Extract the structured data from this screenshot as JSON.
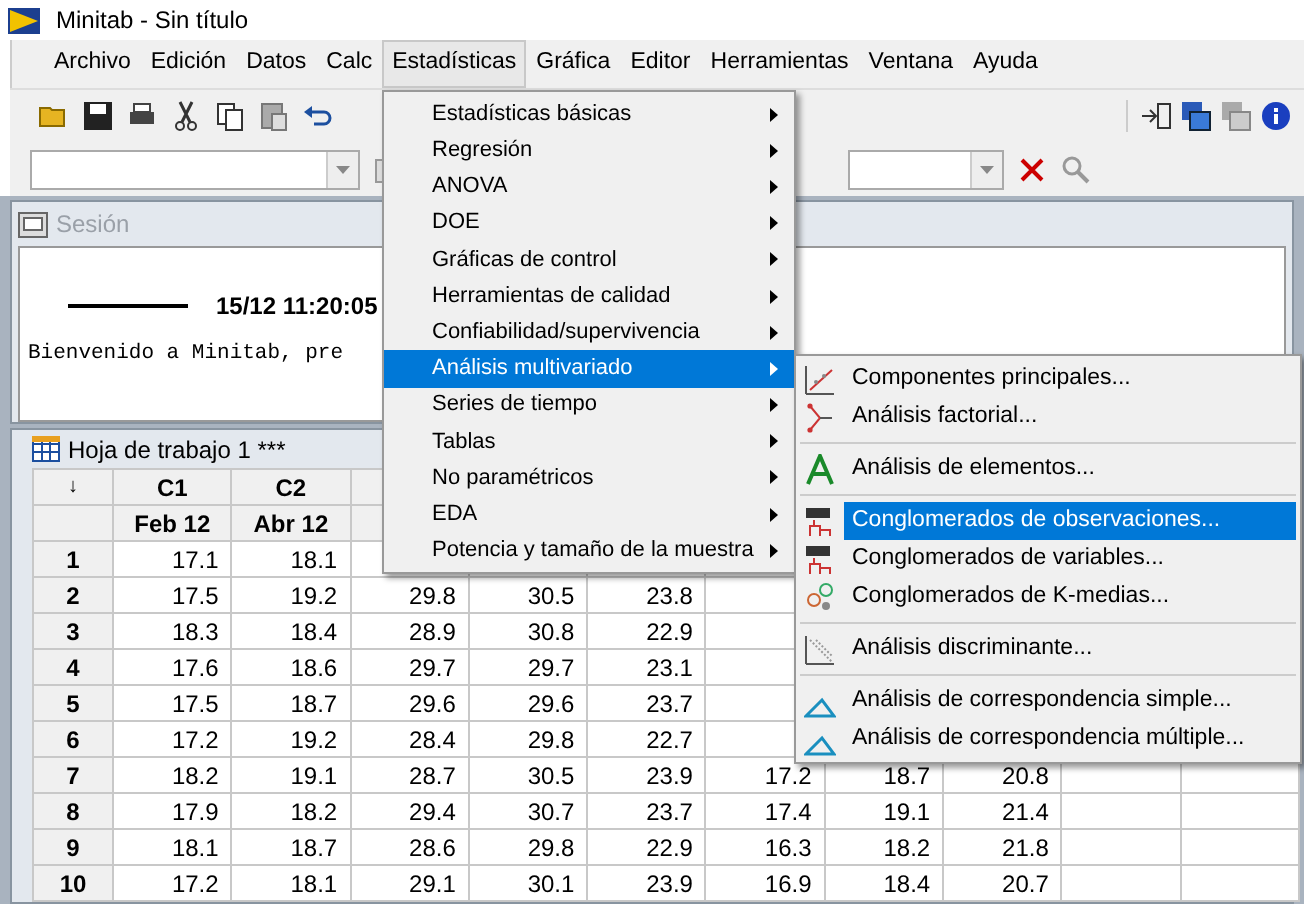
{
  "window": {
    "title": "Minitab - Sin título"
  },
  "menubar": [
    {
      "label": "Archivo",
      "selected": false
    },
    {
      "label": "Edición",
      "selected": false
    },
    {
      "label": "Datos",
      "selected": false
    },
    {
      "label": "Calc",
      "selected": false
    },
    {
      "label": "Estadísticas",
      "selected": true
    },
    {
      "label": "Gráfica",
      "selected": false
    },
    {
      "label": "Editor",
      "selected": false
    },
    {
      "label": "Herramientas",
      "selected": false
    },
    {
      "label": "Ventana",
      "selected": false
    },
    {
      "label": "Ayuda",
      "selected": false
    }
  ],
  "session": {
    "title": "Sesión",
    "timestamp": "15/12 11:20:05",
    "message": "Bienvenido a Minitab, pre"
  },
  "worksheet": {
    "title": "Hoja de trabajo 1 ***",
    "corner": "↓",
    "columns": [
      {
        "name": "C1",
        "label": "Feb 12"
      },
      {
        "name": "C2",
        "label": "Abr 12"
      }
    ],
    "rows": [
      {
        "number": "1",
        "cells": [
          "17.1",
          "18.1"
        ]
      },
      {
        "number": "2",
        "cells": [
          "17.5",
          "19.2",
          "29.8",
          "30.5",
          "23.8"
        ]
      },
      {
        "number": "3",
        "cells": [
          "18.3",
          "18.4",
          "28.9",
          "30.8",
          "22.9"
        ]
      },
      {
        "number": "4",
        "cells": [
          "17.6",
          "18.6",
          "29.7",
          "29.7",
          "23.1"
        ]
      },
      {
        "number": "5",
        "cells": [
          "17.5",
          "18.7",
          "29.6",
          "29.6",
          "23.7"
        ]
      },
      {
        "number": "6",
        "cells": [
          "17.2",
          "19.2",
          "28.4",
          "29.8",
          "22.7"
        ]
      },
      {
        "number": "7",
        "cells": [
          "18.2",
          "19.1",
          "28.7",
          "30.5",
          "23.9",
          "17.2",
          "18.7",
          "20.8"
        ]
      },
      {
        "number": "8",
        "cells": [
          "17.9",
          "18.2",
          "29.4",
          "30.7",
          "23.7",
          "17.4",
          "19.1",
          "21.4"
        ]
      },
      {
        "number": "9",
        "cells": [
          "18.1",
          "18.7",
          "28.6",
          "29.8",
          "22.9",
          "16.3",
          "18.2",
          "21.8"
        ]
      },
      {
        "number": "10",
        "cells": [
          "17.2",
          "18.1",
          "29.1",
          "30.1",
          "23.9",
          "16.9",
          "18.4",
          "20.7"
        ]
      }
    ]
  },
  "menu": [
    {
      "label": "Estadísticas básicas",
      "selected": false
    },
    {
      "label": "Regresión",
      "selected": false
    },
    {
      "label": "ANOVA",
      "selected": false
    },
    {
      "label": "DOE",
      "selected": false
    },
    {
      "label": "Gráficas de control",
      "selected": false
    },
    {
      "label": "Herramientas de calidad",
      "selected": false
    },
    {
      "label": "Confiabilidad/supervivencia",
      "selected": false
    },
    {
      "label": "Análisis multivariado",
      "selected": true
    },
    {
      "label": "Series de tiempo",
      "selected": false
    },
    {
      "label": "Tablas",
      "selected": false
    },
    {
      "label": "No paramétricos",
      "selected": false
    },
    {
      "label": "EDA",
      "selected": false
    },
    {
      "label": "Potencia y tamaño de la muestra",
      "selected": false
    }
  ],
  "submenu": [
    [
      {
        "label": "Componentes principales...",
        "selected": false
      },
      {
        "label": "Análisis factorial...",
        "selected": false
      }
    ],
    [
      {
        "label": "Análisis de elementos...",
        "selected": false
      }
    ],
    [
      {
        "label": "Conglomerados de observaciones...",
        "selected": true
      },
      {
        "label": "Conglomerados de variables...",
        "selected": false
      },
      {
        "label": "Conglomerados de K-medias...",
        "selected": false
      }
    ],
    [
      {
        "label": "Análisis discriminante...",
        "selected": false
      }
    ],
    [
      {
        "label": "Análisis de correspondencia simple...",
        "selected": false
      },
      {
        "label": "Análisis de correspondencia múltiple...",
        "selected": false
      }
    ]
  ]
}
